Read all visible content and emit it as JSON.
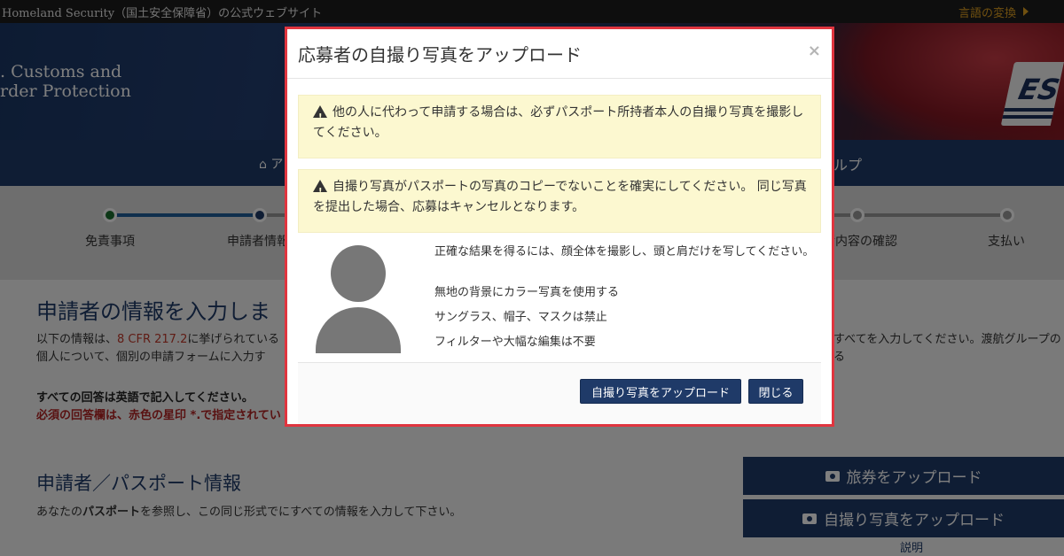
{
  "topbar": {
    "site_text": "Homeland Security（国土安全保障省）の公式ウェブサイト",
    "language_label": "言語の変換"
  },
  "banner": {
    "agency_line1": ". Customs and",
    "agency_line2": "rder Protection",
    "logo_text": "ES"
  },
  "navbar": {
    "home_fragment": "ア",
    "help_fragment": "ルプ"
  },
  "progress": {
    "steps": [
      {
        "label": "免責事項",
        "state": "done"
      },
      {
        "label": "申請者情報",
        "state": "current"
      },
      {
        "label": "請内容の確認",
        "state": "pending"
      },
      {
        "label": "支払い",
        "state": "pending"
      }
    ],
    "colors": {
      "done": "#1a6f2e",
      "current": "#1f3a68",
      "pending": "#9b9b9b",
      "line_done": "#1f5e9a",
      "line_pending": "#999999"
    }
  },
  "content": {
    "title": "申請者の情報を入力しま",
    "intro_line1_prefix": "以下の情報は、",
    "intro_line1_link": "8 CFR 217.2",
    "intro_line1_suffix": "に挙げられている",
    "intro_line2": "個人について、個別の申請フォームに入力す",
    "intro_right1": "すべてを入力してください。渡航グループの",
    "intro_right2": "る",
    "english_notice": "すべての回答は英語で記入してください。",
    "required_notice": "必須の回答欄は、赤色の星印 *.で指定されてい",
    "section_title": "申請者／パスポート情報",
    "section_desc_prefix": "あなたの",
    "section_desc_bold": "パスポート",
    "section_desc_suffix": "を参照し、この同じ形式でにすべての情報を入力して下さい。",
    "upload_passport": "旅券をアップロード",
    "upload_selfie": "自撮り写真をアップロード",
    "explain_link": "説明"
  },
  "modal": {
    "title": "応募者の自撮り写真をアップロード",
    "close_symbol": "×",
    "alert1": "他の人に代わって申請する場合は、必ずパスポート所持者本人の自撮り写真を撮影してください。",
    "alert2": "自撮り写真がパスポートの写真のコピーでないことを確実にしてください。 同じ写真を提出した場合、応募はキャンセルとなります。",
    "tips": [
      "正確な結果を得るには、顔全体を撮影し、頭と肩だけを写してください。",
      "無地の背景にカラー写真を使用する",
      "サングラス、帽子、マスクは禁止",
      "フィルターや大幅な編集は不要"
    ],
    "upload_button": "自撮り写真をアップロード",
    "close_button": "閉じる"
  },
  "colors": {
    "navy": "#1f3a68",
    "highlight_border": "#e0353f",
    "alert_bg": "#fcf8d0",
    "avatar": "#777777"
  }
}
